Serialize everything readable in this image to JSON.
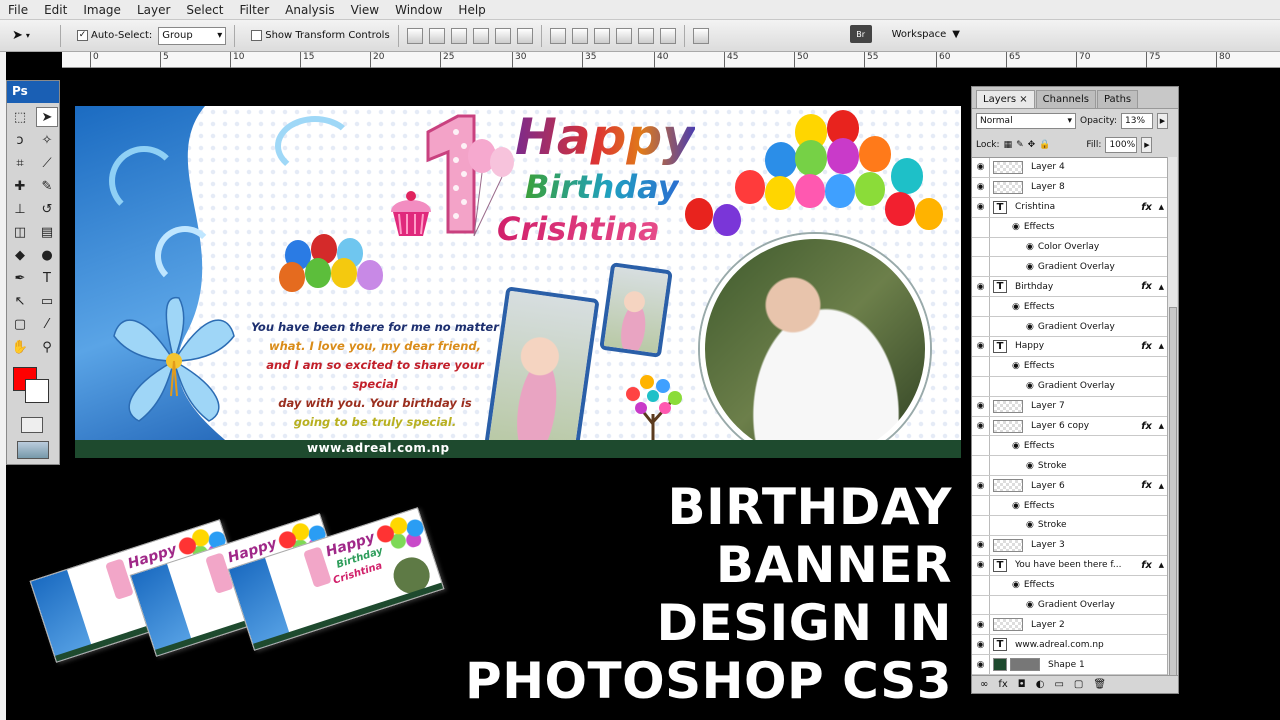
{
  "menu": [
    "File",
    "Edit",
    "Image",
    "Layer",
    "Select",
    "Filter",
    "Analysis",
    "View",
    "Window",
    "Help"
  ],
  "options_bar": {
    "auto_select_label": "Auto-Select:",
    "auto_select_checked": true,
    "auto_select_value": "Group",
    "transform_label": "Show Transform Controls",
    "transform_checked": false,
    "workspace_label": "Workspace",
    "bridge_label": "Br"
  },
  "ruler_ticks": [
    "0",
    "5",
    "10",
    "15",
    "20",
    "25",
    "30",
    "35",
    "40",
    "45",
    "50",
    "55",
    "60",
    "65",
    "70",
    "75",
    "80"
  ],
  "toolbox": {
    "logo": "Ps",
    "foreground_color": "#ff0000",
    "background_color": "#ffffff"
  },
  "banner": {
    "number": "1",
    "happy": "Happy",
    "birthday": "Birthday",
    "name": "Crishtina",
    "message": {
      "line1": "You have been there for me no matter",
      "line2": "what. I love you, my dear friend,",
      "line3": "and I am so excited to share your special",
      "line4": "day with you. Your birthday is",
      "line5": "going to be truly special."
    },
    "url": "www.adreal.com.np"
  },
  "thumbnails": {
    "happy": "Happy",
    "birthday": "Birthday",
    "name": "Crishtina"
  },
  "big_title": {
    "line1": "BIRTHDAY BANNER",
    "line2": "DESIGN IN",
    "line3": "PHOTOSHOP CS3"
  },
  "layers_panel": {
    "tabs": [
      "Layers",
      "Channels",
      "Paths"
    ],
    "close_glyph": "×",
    "blend_mode": "Normal",
    "opacity_label": "Opacity:",
    "opacity_value": "13%",
    "lock_label": "Lock:",
    "fill_label": "Fill:",
    "fill_value": "100%",
    "layers": [
      {
        "kind": "layer",
        "name": "Layer 4"
      },
      {
        "kind": "layer",
        "name": "Layer 8"
      },
      {
        "kind": "text",
        "name": "Crishtina",
        "fx": true
      },
      {
        "kind": "effects",
        "name": "Effects"
      },
      {
        "kind": "effect",
        "name": "Color Overlay"
      },
      {
        "kind": "effect",
        "name": "Gradient Overlay"
      },
      {
        "kind": "text",
        "name": "Birthday",
        "fx": true
      },
      {
        "kind": "effects",
        "name": "Effects"
      },
      {
        "kind": "effect",
        "name": "Gradient Overlay"
      },
      {
        "kind": "text",
        "name": "Happy",
        "fx": true
      },
      {
        "kind": "effects",
        "name": "Effects"
      },
      {
        "kind": "effect",
        "name": "Gradient Overlay"
      },
      {
        "kind": "layer",
        "name": "Layer 7"
      },
      {
        "kind": "layer",
        "name": "Layer 6 copy",
        "fx": true
      },
      {
        "kind": "effects",
        "name": "Effects"
      },
      {
        "kind": "effect",
        "name": "Stroke"
      },
      {
        "kind": "layer",
        "name": "Layer 6",
        "fx": true
      },
      {
        "kind": "effects",
        "name": "Effects"
      },
      {
        "kind": "effect",
        "name": "Stroke"
      },
      {
        "kind": "layer",
        "name": "Layer 3"
      },
      {
        "kind": "text",
        "name": "You have been there f...",
        "fx": true
      },
      {
        "kind": "effects",
        "name": "Effects"
      },
      {
        "kind": "effect",
        "name": "Gradient Overlay"
      },
      {
        "kind": "layer",
        "name": "Layer 2"
      },
      {
        "kind": "text",
        "name": "www.adreal.com.np"
      },
      {
        "kind": "shape",
        "name": "Shape 1"
      }
    ],
    "fx_label": "fx"
  }
}
